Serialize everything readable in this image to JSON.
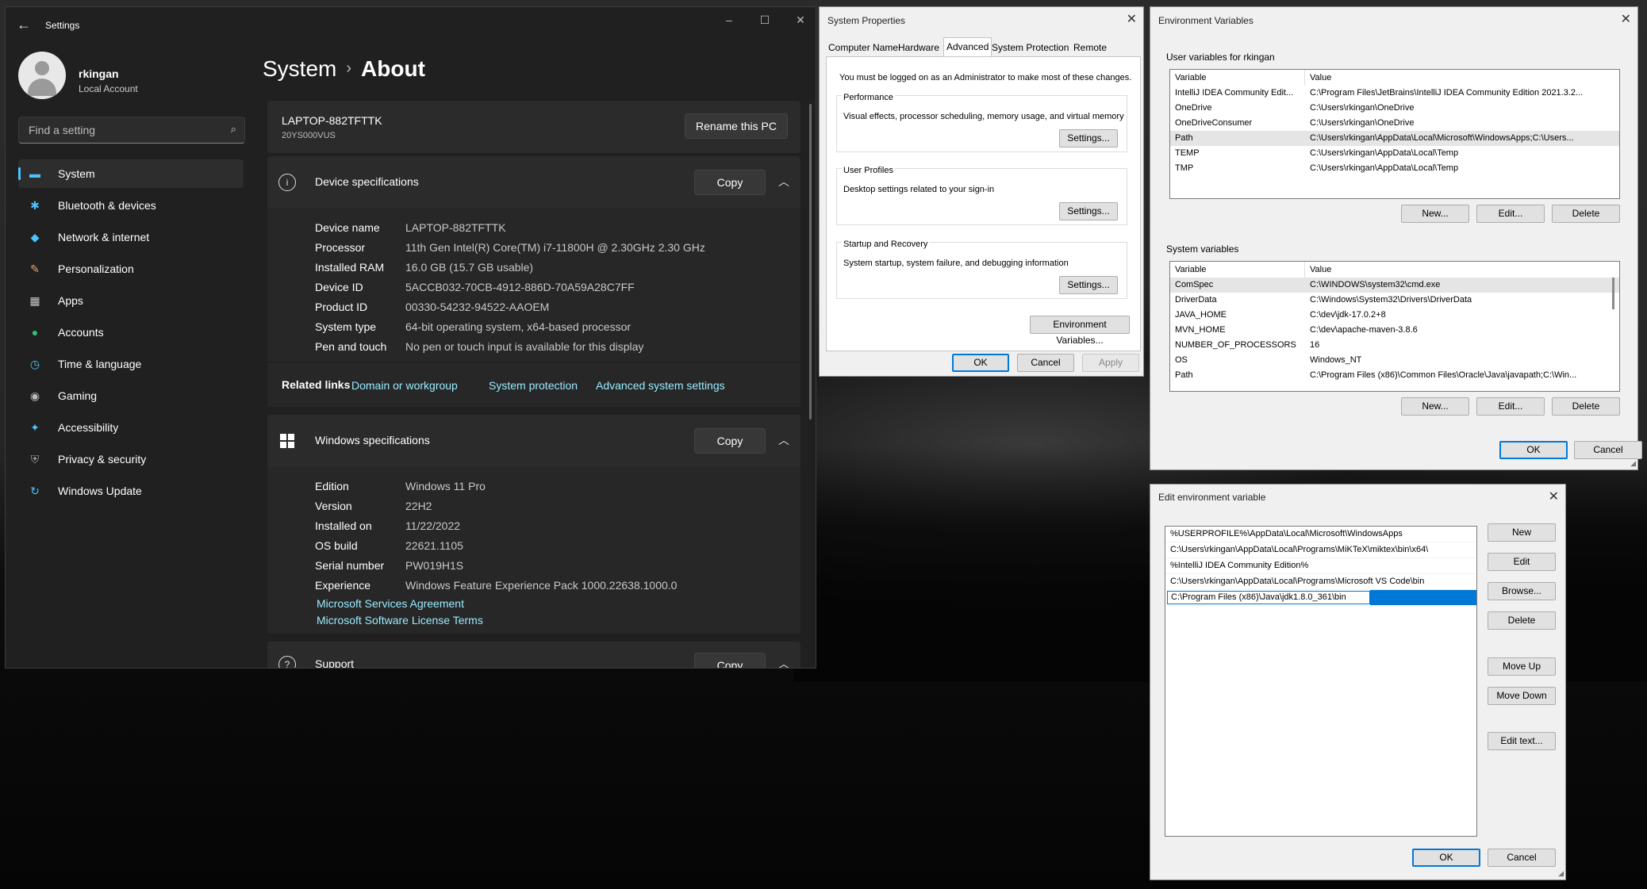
{
  "settings": {
    "app_title": "Settings",
    "window_controls": {
      "minimize": "–",
      "maximize": "☐",
      "close": "✕"
    },
    "user": {
      "name": "rkingan",
      "account_type": "Local Account"
    },
    "search": {
      "placeholder": "Find a setting"
    },
    "nav": [
      {
        "label": "System",
        "icon": "monitor-icon",
        "glyph": "▬",
        "color": "#4cc2ff"
      },
      {
        "label": "Bluetooth & devices",
        "icon": "bluetooth-icon",
        "glyph": "✱",
        "color": "#4cc2ff"
      },
      {
        "label": "Network & internet",
        "icon": "wifi-icon",
        "glyph": "◆",
        "color": "#4cc2ff"
      },
      {
        "label": "Personalization",
        "icon": "brush-icon",
        "glyph": "✎",
        "color": "#e8a86b"
      },
      {
        "label": "Apps",
        "icon": "apps-icon",
        "glyph": "▦",
        "color": "#c8c8c8"
      },
      {
        "label": "Accounts",
        "icon": "person-icon",
        "glyph": "●",
        "color": "#2fc27a"
      },
      {
        "label": "Time & language",
        "icon": "globe-clock-icon",
        "glyph": "◷",
        "color": "#4cc2ff"
      },
      {
        "label": "Gaming",
        "icon": "gamepad-icon",
        "glyph": "◉",
        "color": "#bdbdbd"
      },
      {
        "label": "Accessibility",
        "icon": "accessibility-icon",
        "glyph": "✦",
        "color": "#4cc2ff"
      },
      {
        "label": "Privacy & security",
        "icon": "shield-icon",
        "glyph": "⛨",
        "color": "#9aa0a6"
      },
      {
        "label": "Windows Update",
        "icon": "update-icon",
        "glyph": "↻",
        "color": "#4cc2ff"
      }
    ],
    "breadcrumb": {
      "parent": "System",
      "separator": "›",
      "current": "About"
    },
    "pc": {
      "name": "LAPTOP-882TFTTK",
      "model": "20YS000VUS",
      "rename_label": "Rename this PC"
    },
    "device_specs": {
      "title": "Device specifications",
      "copy_label": "Copy",
      "rows": [
        {
          "k": "Device name",
          "v": "LAPTOP-882TFTTK"
        },
        {
          "k": "Processor",
          "v": "11th Gen Intel(R) Core(TM) i7-11800H @ 2.30GHz   2.30 GHz"
        },
        {
          "k": "Installed RAM",
          "v": "16.0 GB (15.7 GB usable)"
        },
        {
          "k": "Device ID",
          "v": "5ACCB032-70CB-4912-886D-70A59A28C7FF"
        },
        {
          "k": "Product ID",
          "v": "00330-54232-94522-AAOEM"
        },
        {
          "k": "System type",
          "v": "64-bit operating system, x64-based processor"
        },
        {
          "k": "Pen and touch",
          "v": "No pen or touch input is available for this display"
        }
      ]
    },
    "related": {
      "label": "Related links",
      "links": [
        "Domain or workgroup",
        "System protection",
        "Advanced system settings"
      ]
    },
    "windows_specs": {
      "title": "Windows specifications",
      "copy_label": "Copy",
      "rows": [
        {
          "k": "Edition",
          "v": "Windows 11 Pro"
        },
        {
          "k": "Version",
          "v": "22H2"
        },
        {
          "k": "Installed on",
          "v": "11/22/2022"
        },
        {
          "k": "OS build",
          "v": "22621.1105"
        },
        {
          "k": "Serial number",
          "v": "PW019H1S"
        },
        {
          "k": "Experience",
          "v": "Windows Feature Experience Pack 1000.22638.1000.0"
        }
      ],
      "links": [
        "Microsoft Services Agreement",
        "Microsoft Software License Terms"
      ]
    },
    "support": {
      "title": "Support",
      "copy_label": "Copy"
    }
  },
  "system_properties": {
    "title": "System Properties",
    "close": "✕",
    "tabs": [
      "Computer Name",
      "Hardware",
      "Advanced",
      "System Protection",
      "Remote"
    ],
    "selected_tab": "Advanced",
    "note": "You must be logged on as an Administrator to make most of these changes.",
    "groups": [
      {
        "title": "Performance",
        "desc": "Visual effects, processor scheduling, memory usage, and virtual memory",
        "button": "Settings..."
      },
      {
        "title": "User Profiles",
        "desc": "Desktop settings related to your sign-in",
        "button": "Settings..."
      },
      {
        "title": "Startup and Recovery",
        "desc": "System startup, system failure, and debugging information",
        "button": "Settings..."
      }
    ],
    "env_button": "Environment Variables...",
    "ok": "OK",
    "cancel": "Cancel",
    "apply": "Apply"
  },
  "env_vars": {
    "title": "Environment Variables",
    "close": "✕",
    "user_label": "User variables for rkingan",
    "col_variable": "Variable",
    "col_value": "Value",
    "user_rows": [
      {
        "var": "IntelliJ IDEA Community Edit...",
        "val": "C:\\Program Files\\JetBrains\\IntelliJ IDEA Community Edition 2021.3.2..."
      },
      {
        "var": "OneDrive",
        "val": "C:\\Users\\rkingan\\OneDrive"
      },
      {
        "var": "OneDriveConsumer",
        "val": "C:\\Users\\rkingan\\OneDrive"
      },
      {
        "var": "Path",
        "val": "C:\\Users\\rkingan\\AppData\\Local\\Microsoft\\WindowsApps;C:\\Users..."
      },
      {
        "var": "TEMP",
        "val": "C:\\Users\\rkingan\\AppData\\Local\\Temp"
      },
      {
        "var": "TMP",
        "val": "C:\\Users\\rkingan\\AppData\\Local\\Temp"
      }
    ],
    "system_label": "System variables",
    "system_rows": [
      {
        "var": "ComSpec",
        "val": "C:\\WINDOWS\\system32\\cmd.exe"
      },
      {
        "var": "DriverData",
        "val": "C:\\Windows\\System32\\Drivers\\DriverData"
      },
      {
        "var": "JAVA_HOME",
        "val": "C:\\dev\\jdk-17.0.2+8"
      },
      {
        "var": "MVN_HOME",
        "val": "C:\\dev\\apache-maven-3.8.6"
      },
      {
        "var": "NUMBER_OF_PROCESSORS",
        "val": "16"
      },
      {
        "var": "OS",
        "val": "Windows_NT"
      },
      {
        "var": "Path",
        "val": "C:\\Program Files (x86)\\Common Files\\Oracle\\Java\\javapath;C:\\Win..."
      }
    ],
    "new": "New...",
    "edit": "Edit...",
    "delete": "Delete",
    "ok": "OK",
    "cancel": "Cancel"
  },
  "edit_env": {
    "title": "Edit environment variable",
    "close": "✕",
    "entries": [
      "%USERPROFILE%\\AppData\\Local\\Microsoft\\WindowsApps",
      "C:\\Users\\rkingan\\AppData\\Local\\Programs\\MiKTeX\\miktex\\bin\\x64\\",
      "%IntelliJ IDEA Community Edition%",
      "C:\\Users\\rkingan\\AppData\\Local\\Programs\\Microsoft VS Code\\bin"
    ],
    "editing_value": "C:\\Program Files (x86)\\Java\\jdk1.8.0_361\\bin",
    "buttons": {
      "new": "New",
      "edit": "Edit",
      "browse": "Browse...",
      "delete": "Delete",
      "move_up": "Move Up",
      "move_down": "Move Down",
      "edit_text": "Edit text..."
    },
    "ok": "OK",
    "cancel": "Cancel"
  }
}
